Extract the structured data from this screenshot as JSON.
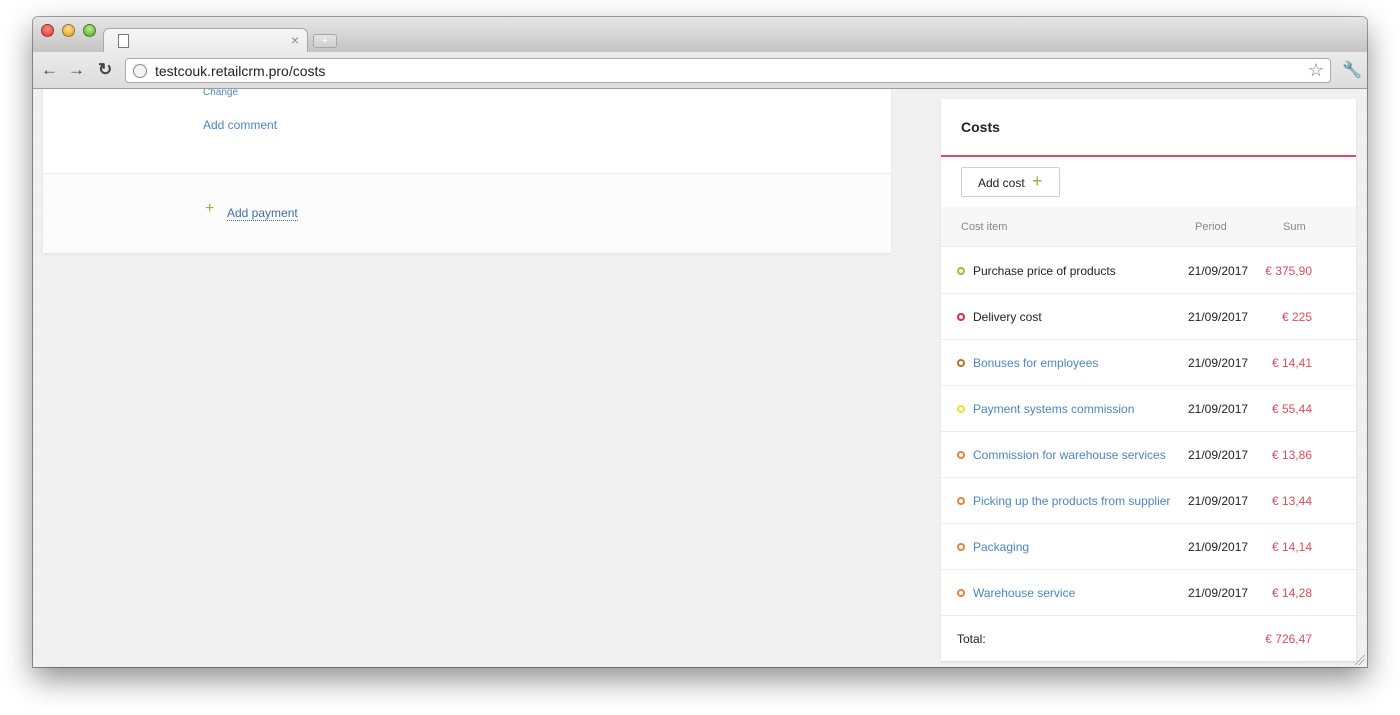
{
  "browser": {
    "tab_close": "×",
    "new_tab": "+",
    "url": "testcouk.retailcrm.pro/costs",
    "icons": [
      "back-arrow-icon",
      "forward-arrow-icon",
      "reload-icon",
      "globe-icon",
      "bookmark-star-icon",
      "wrench-icon"
    ]
  },
  "order": {
    "change_link": "Change",
    "add_comment": "Add comment",
    "add_payment": "Add payment"
  },
  "costs": {
    "title": "Costs",
    "add_cost_label": "Add cost",
    "columns": {
      "item": "Cost item",
      "period": "Period",
      "sum": "Sum"
    },
    "rows": [
      {
        "name": "Purchase price of products",
        "date": "21/09/2017",
        "sum": "€ 375,90",
        "dot_color": "#8cc63f",
        "is_link": false
      },
      {
        "name": "Delivery cost",
        "date": "21/09/2017",
        "sum": "€ 225",
        "dot_color": "#e2293f",
        "is_link": false
      },
      {
        "name": "Bonuses for employees",
        "date": "21/09/2017",
        "sum": "€ 14,41",
        "dot_color": "#b3761f",
        "is_link": true
      },
      {
        "name": "Payment systems commission",
        "date": "21/09/2017",
        "sum": "€ 55,44",
        "dot_color": "#f2e12a",
        "is_link": true
      },
      {
        "name": "Commission for warehouse services",
        "date": "21/09/2017",
        "sum": "€ 13,86",
        "dot_color": "#e8833a",
        "is_link": true
      },
      {
        "name": "Picking up the products from supplier",
        "date": "21/09/2017",
        "sum": "€ 13,44",
        "dot_color": "#e8833a",
        "is_link": true
      },
      {
        "name": "Packaging",
        "date": "21/09/2017",
        "sum": "€ 14,14",
        "dot_color": "#e8833a",
        "is_link": true
      },
      {
        "name": "Warehouse service",
        "date": "21/09/2017",
        "sum": "€ 14,28",
        "dot_color": "#e8833a",
        "is_link": true
      }
    ],
    "total_label": "Total:",
    "total_sum": "€ 726,47"
  },
  "colors": {
    "accent_red": "#e5485d",
    "link_blue": "#4a86c5",
    "plus_green": "#83bd3c"
  }
}
